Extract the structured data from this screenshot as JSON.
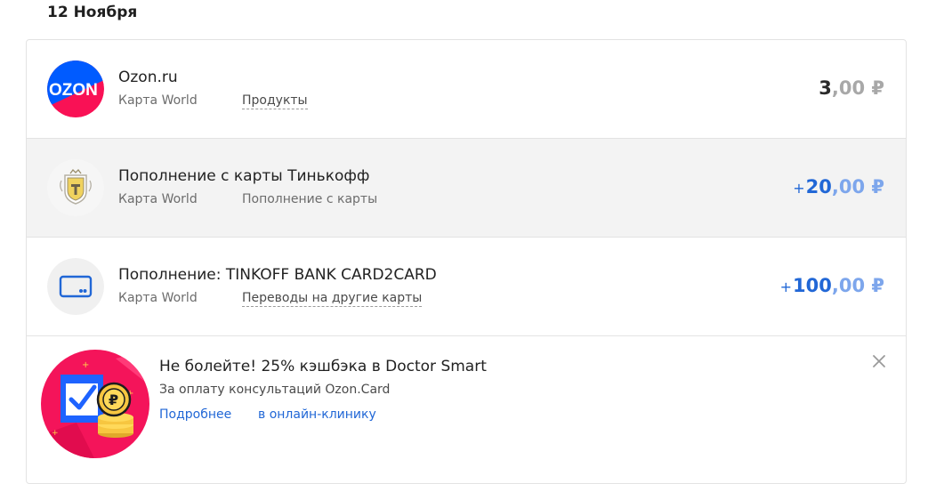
{
  "date_heading": "12 Ноября",
  "transactions": [
    {
      "title": "Ozon.ru",
      "card": "Карта World",
      "category": "Продукты",
      "amount_sign": "",
      "amount_int": "3",
      "amount_frac": ",00 ₽",
      "icon": "ozon-logo-icon"
    },
    {
      "title": "Пополнение с карты Тинькофф",
      "card": "Карта World",
      "category": "Пополнение с карты",
      "amount_sign": "+",
      "amount_int": "20",
      "amount_frac": ",00 ₽",
      "icon": "tinkoff-logo-icon"
    },
    {
      "title": "Пополнение: TINKOFF BANK CARD2CARD",
      "card": "Карта World",
      "category": "Переводы на другие карты",
      "amount_sign": "+",
      "amount_int": "100",
      "amount_frac": ",00 ₽",
      "icon": "card-icon"
    }
  ],
  "promo": {
    "title": "Не болейте! 25% кэшбэка в Doctor Smart",
    "text": "За оплату консультаций Ozon.Card",
    "link_more": "Подробнее",
    "link_clinic": "в онлайн-клинику",
    "ozon_logo_text": "OZON"
  },
  "colors": {
    "accent_blue": "#2167d6",
    "ozon_blue": "#005bff",
    "ozon_pink": "#f91155"
  }
}
